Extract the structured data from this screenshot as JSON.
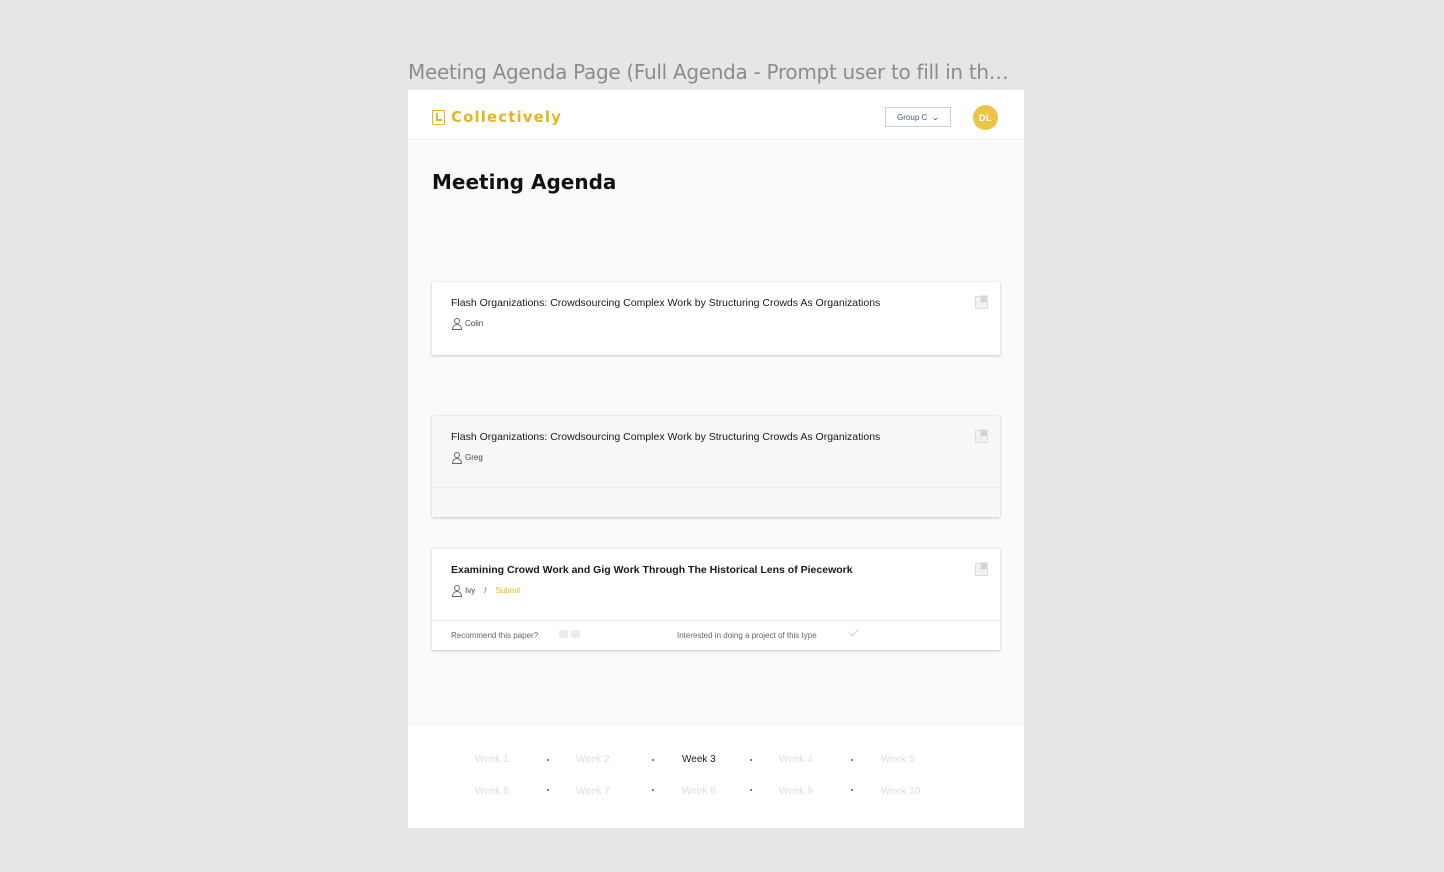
{
  "frame_title": "Meeting Agenda Page (Full Agenda - Prompt user to fill in th…",
  "header": {
    "brand": "Collectively",
    "group_select": "Group C",
    "avatar_initials": "DL"
  },
  "page_title": "Meeting Agenda",
  "cards": [
    {
      "title": "Flash Organizations: Crowdsourcing Complex Work by Structuring Crowds As Organizations",
      "presenter": "Colin"
    },
    {
      "title": "Flash Organizations: Crowdsourcing Complex Work by Structuring Crowds As Organizations",
      "presenter": "Greg"
    },
    {
      "title": "Examining Crowd Work and Gig Work Through The Historical Lens of Piecework",
      "presenter": "Ivy",
      "separator": "/",
      "submit_label": "Submit",
      "recommend_label": "Recommend this paper?",
      "interest_label": "Interested in doing a project of this type"
    }
  ],
  "weeks": {
    "row1": [
      "Week 1",
      "Week 2",
      "Week 3",
      "Week 4",
      "Week 5"
    ],
    "row2": [
      "Week 6",
      "Week 7",
      "Week 8",
      "Week 9",
      "Week 10"
    ],
    "active": "Week 3"
  },
  "colors": {
    "brand": "#e6b523",
    "avatar": "#ecc548",
    "select_text": "#3a5f99"
  }
}
